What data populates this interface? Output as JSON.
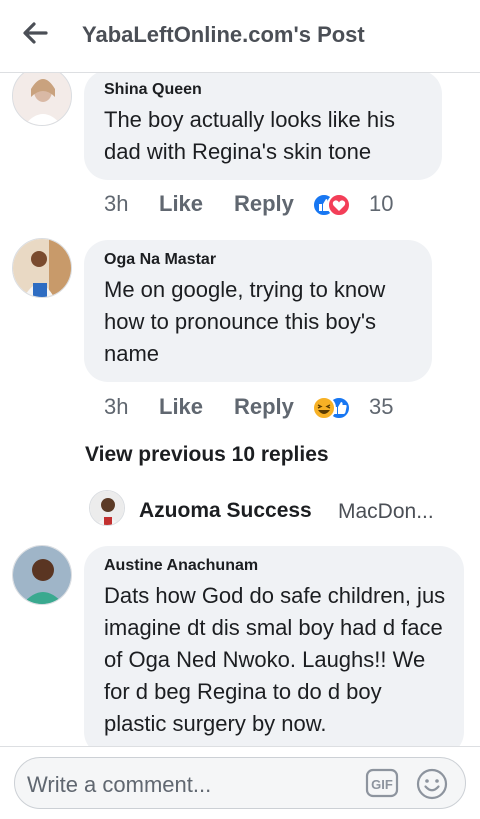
{
  "header": {
    "title": "YabaLeftOnline.com's Post"
  },
  "comments": [
    {
      "author": "Shina Queen",
      "text": "The boy actually looks like his dad with Regina's skin tone",
      "time": "3h",
      "like_label": "Like",
      "reply_label": "Reply",
      "reaction_count": "10",
      "reactions": [
        "like",
        "love"
      ]
    },
    {
      "author": "Oga Na Mastar",
      "text": "Me on google, trying to know how to pronounce this boy's name",
      "time": "3h",
      "like_label": "Like",
      "reply_label": "Reply",
      "reaction_count": "35",
      "reactions": [
        "haha",
        "like"
      ]
    },
    {
      "author": "Austine Anachunam",
      "text": "Dats how God do safe children, jus imagine dt dis smal boy had d face of Oga Ned Nwoko. Laughs!! We for d beg Regina to do d boy plastic surgery by now."
    }
  ],
  "thread": {
    "view_previous": "View previous 10 replies",
    "reply_author": "Azuoma Success",
    "reply_snippet": "MacDon..."
  },
  "composer": {
    "placeholder": "Write a comment...",
    "gif_label": "GIF"
  },
  "colors": {
    "like_blue": "#1877f2",
    "love_red": "#f33e58",
    "haha_yellow": "#f7b125",
    "bubble": "#f0f2f5"
  }
}
